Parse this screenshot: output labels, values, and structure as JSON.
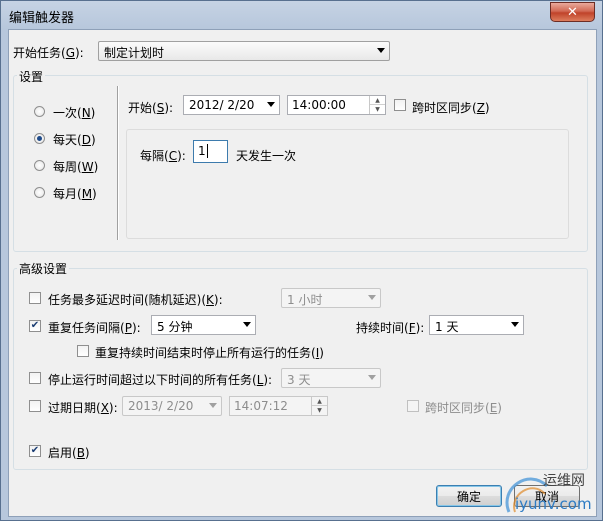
{
  "window": {
    "title": "编辑触发器",
    "close_label": "✕"
  },
  "begin_task": {
    "label": "开始任务(",
    "key": "G",
    "suffix": "):",
    "value": "制定计划时"
  },
  "settings": {
    "group_label": "设置",
    "radios": [
      {
        "label": "一次(",
        "key": "N",
        "suffix": ")",
        "selected": false
      },
      {
        "label": "每天(",
        "key": "D",
        "suffix": ")",
        "selected": true
      },
      {
        "label": "每周(",
        "key": "W",
        "suffix": ")",
        "selected": false
      },
      {
        "label": "每月(",
        "key": "M",
        "suffix": ")",
        "selected": false
      }
    ],
    "start_label": "开始(",
    "start_key": "S",
    "start_suffix": "):",
    "start_date": "2012/  2/20",
    "start_time": "14:00:00",
    "sync_label": "跨时区同步(",
    "sync_key": "Z",
    "sync_suffix": ")",
    "every_label": "每隔(",
    "every_key": "C",
    "every_suffix": "):",
    "every_value": "1",
    "every_unit": "天发生一次"
  },
  "advanced": {
    "group_label": "高级设置",
    "delay": {
      "label": "任务最多延迟时间(随机延迟)(",
      "key": "K",
      "suffix": "):",
      "value": "1 小时",
      "checked": false
    },
    "repeat": {
      "label": "重复任务间隔(",
      "key": "P",
      "suffix": "):",
      "value": "5 分钟",
      "checked": true,
      "duration_label": "持续时间(",
      "duration_key": "F",
      "duration_suffix": "):",
      "duration_value": "1 天"
    },
    "stop_at_end": {
      "label": "重复持续时间结束时停止所有运行的任务(",
      "key": "I",
      "suffix": ")",
      "checked": false
    },
    "stop_longer": {
      "label": "停止运行时间超过以下时间的所有任务(",
      "key": "L",
      "suffix": "):",
      "value": "3 天",
      "checked": false
    },
    "expire": {
      "label": "过期日期(",
      "key": "X",
      "suffix": "):",
      "date": "2013/  2/20",
      "time": "14:07:12",
      "checked": false,
      "sync_label": "跨时区同步(",
      "sync_key": "E",
      "sync_suffix": ")"
    },
    "enabled": {
      "label": "启用(",
      "key": "B",
      "suffix": ")",
      "checked": true
    }
  },
  "buttons": {
    "ok": "确定",
    "cancel": "取消"
  },
  "watermark": {
    "text1": "运维网",
    "text2": "iyunv.com"
  },
  "colors": {
    "accent": "#1e4a8a",
    "check": "#1b3d73"
  }
}
